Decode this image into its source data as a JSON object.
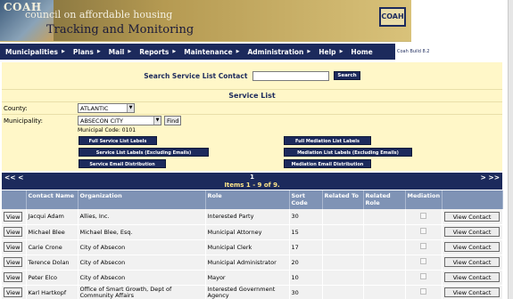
{
  "header": {
    "coah": "COAH",
    "line1": "council on affordable housing",
    "line2": "Tracking and Monitoring",
    "logo": "COAH",
    "build": "Coah Build 8.2"
  },
  "nav": {
    "items": [
      "Municipalities",
      "Plans",
      "Mail",
      "Reports",
      "Maintenance",
      "Administration",
      "Help",
      "Home"
    ]
  },
  "search": {
    "label": "Search Service List Contact",
    "value": "",
    "button": "Search"
  },
  "service_list": {
    "title": "Service List",
    "county_label": "County:",
    "county_value": "ATLANTIC",
    "municipality_label": "Municipality:",
    "municipality_value": "ABSECON CITY",
    "find_button": "Find",
    "municipal_code": "Municipal Code: 0101"
  },
  "label_buttons": {
    "full_service": "Full Service List Labels",
    "service_excl": "Service List Labels (Excluding Emails)",
    "service_email": "Service Email Distribution",
    "full_mediation": "Full Mediation List Labels",
    "mediation_excl": "Mediation List Labels (Excluding Emails)",
    "mediation_email": "Mediation Email Distribution"
  },
  "pager": {
    "prev": "<< <",
    "page": "1",
    "items": "Items 1 - 9 of 9.",
    "next": "> >>"
  },
  "table": {
    "headers": [
      "",
      "Contact Name",
      "Organization",
      "Role",
      "Sort Code",
      "Related To",
      "Related Role",
      "Mediation",
      ""
    ],
    "view_label": "View",
    "view_contact_label": "View Contact",
    "rows": [
      {
        "name": "Jacqui Adam",
        "org": "Allies, Inc.",
        "role": "Interested Party",
        "sort": "30"
      },
      {
        "name": "Michael Blee",
        "org": "Michael Blee, Esq.",
        "role": "Municipal Attorney",
        "sort": "15"
      },
      {
        "name": "Carie Crone",
        "org": "City of Absecon",
        "role": "Municipal Clerk",
        "sort": "17"
      },
      {
        "name": "Terence Dolan",
        "org": "City of Absecon",
        "role": "Municipal Administrator",
        "sort": "20"
      },
      {
        "name": "Peter Elco",
        "org": "City of Absecon",
        "role": "Mayor",
        "sort": "10"
      },
      {
        "name": "Karl Hartkopf",
        "org": "Office of Smart Growth, Dept of Community Affairs",
        "role": "Interested Government Agency",
        "sort": "30"
      }
    ]
  },
  "colors": {
    "navy": "#1c2a5c",
    "panel": "#fff7c8",
    "table_header": "#7f93b5"
  }
}
